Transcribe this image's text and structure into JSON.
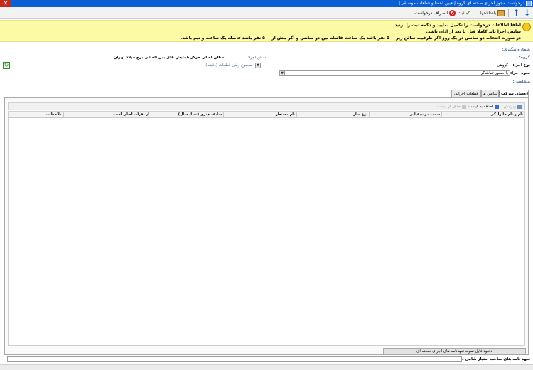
{
  "window": {
    "title": "درخواست مجوز اجرای صحنه ای گروه [تعیین اعضا و قطعات موسیقی]",
    "close": "✕"
  },
  "toolbar": {
    "up": "↑",
    "down": "↓",
    "save": "ثبت",
    "cancel": "انصراف درخواست",
    "notes": "یادداشتها"
  },
  "notice": {
    "line1": "لطفا اطلاعات درخواست را تکمیل نمایید و دکمه ثبت را بزنید.",
    "line2": "سانس اجرا باید کاملا قبل یا بعد از اذان باشد.",
    "line3": "در صورت انتخاب دو سانس در یک روز اگر ظرفیت سالن زیر ۵۰۰ نفر باشد یک ساعت فاصله بین دو سانس و اگر بیش از ۵۰۰ نفر باشد فاصله یک ساعت و نیم باشد."
  },
  "form": {
    "tracking_label": "شماره پیگیری:",
    "group_label": "گروه:",
    "hall_label": "سالن اجرا:",
    "hall_value": "سالن اصلی مرکز همایش های بین المللی برج میلاد تهران",
    "type_label": "نوع اجرا:",
    "type_value": "گروهی",
    "duration_label": "مجموع زمان قطعات (دقیقه)",
    "mode_label": "نحوه اجرا:",
    "mode_value": "با حضور تماشاگر",
    "applicant_label": "متقاضی:",
    "refresh": "↻"
  },
  "tabs": [
    "اعضای شرکت کننده",
    "سانس ها",
    "قطعات اجرایی"
  ],
  "grid_toolbar": {
    "edit": "ویرایش",
    "add": "اضافه به لیست",
    "remove": "حذف از لیست"
  },
  "grid": {
    "columns": [
      "نام و نام خانوادگی",
      "سمت موسیقیایی",
      "نوع ساز",
      "نام مستعار",
      "سابقه هنری (تعداد سال)",
      "از نفرات اصلی است",
      "ملاحظات"
    ]
  },
  "footer": {
    "download": "دانلود فایل نمونه تعهدنامه های اجرای صحنه ای",
    "commitment_label": "تعهد نامه های صاحب امتیاز شامل دو فرم:*"
  }
}
